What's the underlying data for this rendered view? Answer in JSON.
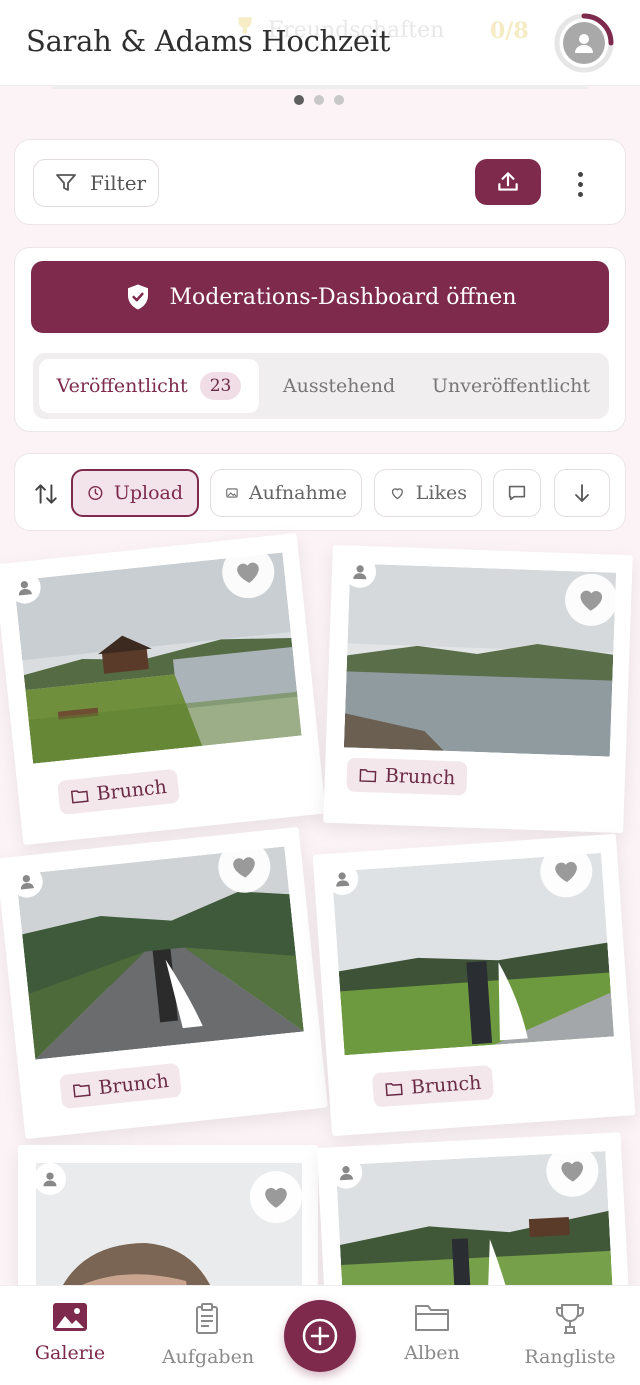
{
  "header": {
    "title": "Sarah & Adams Hochzeit",
    "ghost_label": "Freundschaften",
    "ghost_count": "0/8",
    "avatar_icon": "person-icon"
  },
  "carousel": {
    "pages": 3,
    "active_page": 1
  },
  "toolbar": {
    "filter_label": "Filter",
    "upload_icon": "upload-icon",
    "more_icon": "more-vertical-icon"
  },
  "moderation": {
    "button_label": "Moderations-Dashboard öffnen",
    "tabs": [
      {
        "label": "Veröffentlicht",
        "count": "23",
        "active": true
      },
      {
        "label": "Ausstehend",
        "active": false
      },
      {
        "label": "Unveröffentlicht",
        "active": false
      }
    ]
  },
  "sort": {
    "chips": [
      {
        "label": "Upload",
        "icon": "clock-icon",
        "active": true
      },
      {
        "label": "Aufnahme",
        "icon": "image-icon",
        "active": false
      },
      {
        "label": "Likes",
        "icon": "heart-icon",
        "active": false
      },
      {
        "label": "",
        "icon": "comment-icon",
        "active": false
      }
    ]
  },
  "photos": [
    {
      "album": "Brunch",
      "scene": "lake cabin with picnic table"
    },
    {
      "album": "Brunch",
      "scene": "lake with mountains"
    },
    {
      "album": "Brunch",
      "scene": "couple kissing on road"
    },
    {
      "album": "Brunch",
      "scene": "couple walking in meadow"
    },
    {
      "album": "",
      "scene": "portrait of groom"
    },
    {
      "album": "",
      "scene": "couple in field with barn"
    }
  ],
  "nav": {
    "items": [
      {
        "label": "Galerie",
        "active": true
      },
      {
        "label": "Aufgaben",
        "active": false
      },
      {
        "label": "Alben",
        "active": false
      },
      {
        "label": "Rangliste",
        "active": false
      }
    ]
  },
  "colors": {
    "accent": "#7d2a4c",
    "background": "#fbf3f5"
  }
}
